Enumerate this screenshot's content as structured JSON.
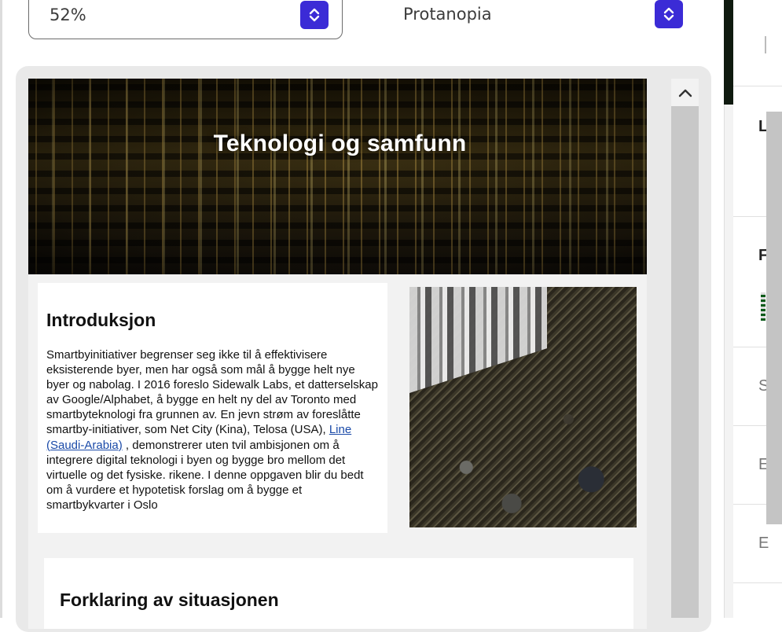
{
  "controls": {
    "zoom_value": "52%",
    "vision_mode": "Protanopia"
  },
  "document": {
    "banner_title": "Teknologi og samfunn",
    "intro": {
      "heading": "Introduksjon",
      "text_before_link": "Smartbyinitiativer begrenser seg ikke til å effektivisere eksisterende byer, men har også som mål å bygge helt nye byer og nabolag. I 2016 foreslo Sidewalk Labs, et datterselskap av Google/Alphabet, å bygge en helt ny del av Toronto med smartbyteknologi fra grunnen av. En jevn strøm av foreslåtte smartby-initiativer, som Net City (Kina), Telosa (USA), ",
      "link_text": "Line (Saudi-Arabia)",
      "text_after_link": " , demonstrerer uten tvil ambisjonen om å integrere digital teknologi i byen og bygge bro mellom det virtuelle og det fysiske. rikene. I denne oppgaven blir du bedt om å vurdere et hypotetisk forslag om å bygge et smartbykvarter i Oslo"
    },
    "explanation": {
      "heading": "Forklaring av situasjonen"
    }
  },
  "right_panel": {
    "items": [
      "L",
      "F",
      "S",
      "E",
      "E"
    ]
  },
  "colors": {
    "stepper": "#3b2bd6",
    "link": "#1a4aa8"
  }
}
